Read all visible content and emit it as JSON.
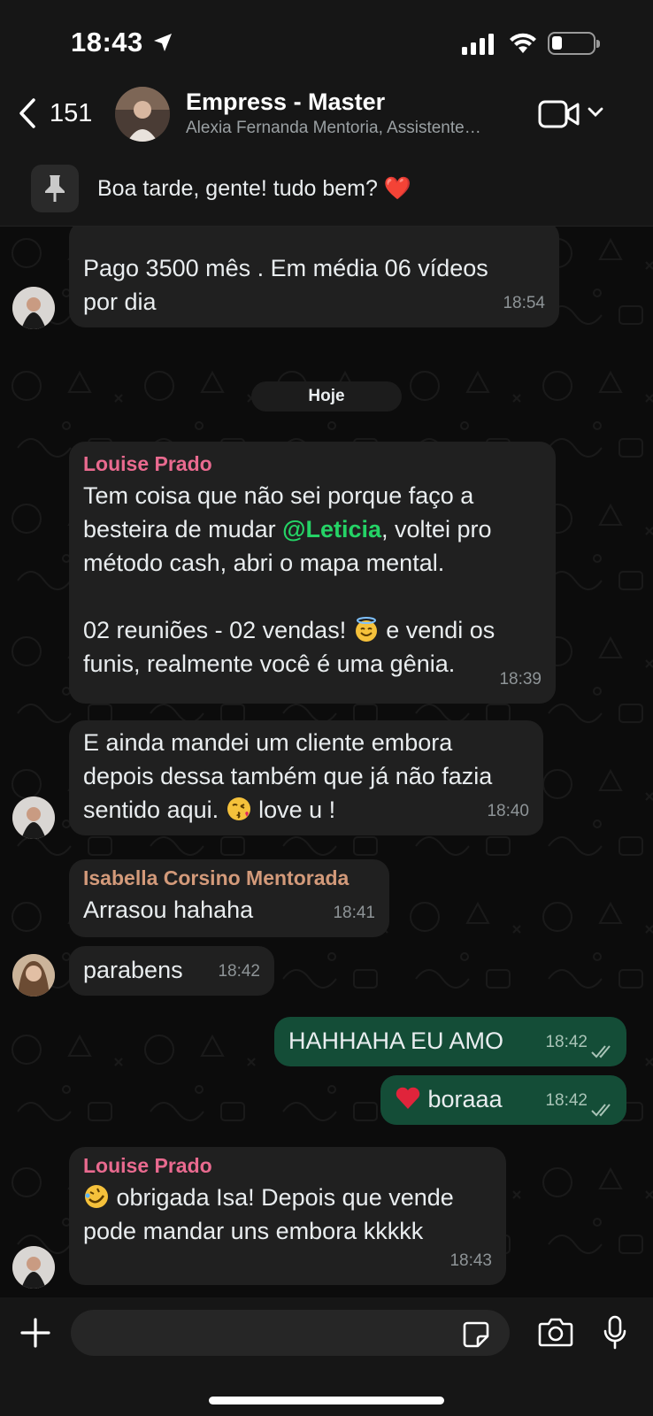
{
  "status_bar": {
    "time": "18:43",
    "location_icon": "location-arrow-icon",
    "signal_icon": "signal-bars-icon",
    "wifi_icon": "wifi-icon",
    "battery_icon": "battery-icon",
    "battery_level": 0.2
  },
  "header": {
    "back_count": "151",
    "title": "Empress - Master",
    "subtitle": "Alexia Fernanda Mentoria, Assistente…",
    "icons": [
      "chevron-left-icon",
      "video-call-icon",
      "chevron-down-icon"
    ]
  },
  "pinned": {
    "text": "Boa tarde, gente! tudo bem? ❤️"
  },
  "date_separator": "Hoje",
  "messages": [
    {
      "id": "m0",
      "sender": "",
      "lines": [
        "Pago 3500 mês . Em média 06 vídeos",
        "por dia"
      ],
      "time": "18:54",
      "direction": "in"
    },
    {
      "id": "m1",
      "sender": "Louise Prado",
      "sender_color": "#e96a8f",
      "lines_a": [
        "Tem coisa que não sei porque faço a"
      ],
      "line_mention_before": "besteira de mudar ",
      "mention": "@Leticia",
      "line_mention_after": ", voltei pro",
      "lines_b": [
        "método cash, abri o mapa mental."
      ],
      "line_emoji_before": "02 reuniões - 02 vendas! ",
      "line_emoji_after": " e vendi os",
      "lines_c": [
        "funis, realmente você é uma gênia."
      ],
      "time": "18:39",
      "direction": "in"
    },
    {
      "id": "m2",
      "sender": "",
      "lines": [
        "E ainda mandei um cliente embora",
        "depois dessa também que já não fazia"
      ],
      "line_emoji_before": "sentido aqui. ",
      "line_emoji_after": " love u !",
      "time": "18:40",
      "direction": "in"
    },
    {
      "id": "m3",
      "sender": "Isabella Corsino Mentorada",
      "sender_color": "#d39a7a",
      "text": "Arrasou hahaha",
      "time": "18:41",
      "direction": "in"
    },
    {
      "id": "m4",
      "sender": "",
      "text": "parabens",
      "time": "18:42",
      "direction": "in"
    },
    {
      "id": "m5",
      "text": "HAHHAHA EU AMO",
      "time": "18:42",
      "direction": "out",
      "status": "read"
    },
    {
      "id": "m6",
      "text": "boraaa",
      "time": "18:42",
      "direction": "out",
      "status": "read"
    },
    {
      "id": "m7",
      "sender": "Louise Prado",
      "sender_color": "#e96a8f",
      "line_emoji_after": " obrigada Isa! Depois que vende",
      "lines": [
        "pode mandar uns embora kkkkk"
      ],
      "time": "18:43",
      "direction": "in"
    }
  ],
  "input_bar": {
    "icons": [
      "plus-icon",
      "sticker-icon",
      "camera-icon",
      "microphone-icon"
    ]
  },
  "colors": {
    "outgoing": "#144d37",
    "incoming": "#202020",
    "mention": "#25d366"
  }
}
